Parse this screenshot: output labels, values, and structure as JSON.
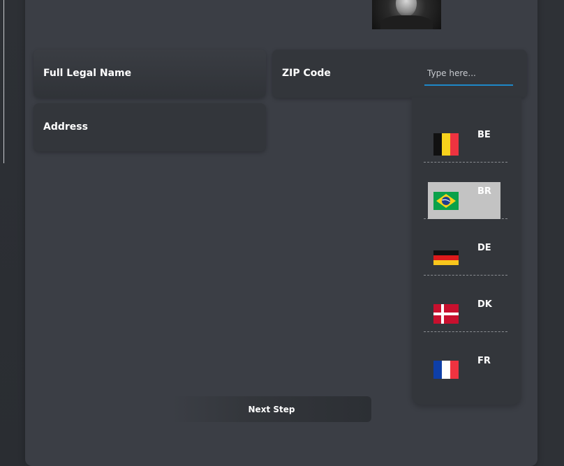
{
  "form": {
    "full_name_label": "Full Legal Name",
    "address_label": "Address",
    "zip_label": "ZIP Code",
    "zip_value": "",
    "zip_placeholder": "Type here..."
  },
  "country_dropdown": {
    "items": [
      {
        "code": "BE",
        "flag": "belgium-flag",
        "selected": false
      },
      {
        "code": "BR",
        "flag": "brazil-flag",
        "selected": true
      },
      {
        "code": "DE",
        "flag": "germany-flag",
        "selected": false
      },
      {
        "code": "DK",
        "flag": "denmark-flag",
        "selected": false
      },
      {
        "code": "FR",
        "flag": "france-flag",
        "selected": false
      }
    ]
  },
  "actions": {
    "next_label": "Next Step"
  },
  "colors": {
    "card_bg": "#3b3e45",
    "field_bg": "#33363b",
    "input_underline": "#1e88c8",
    "selected_item_bg": "#c3c3c3"
  }
}
